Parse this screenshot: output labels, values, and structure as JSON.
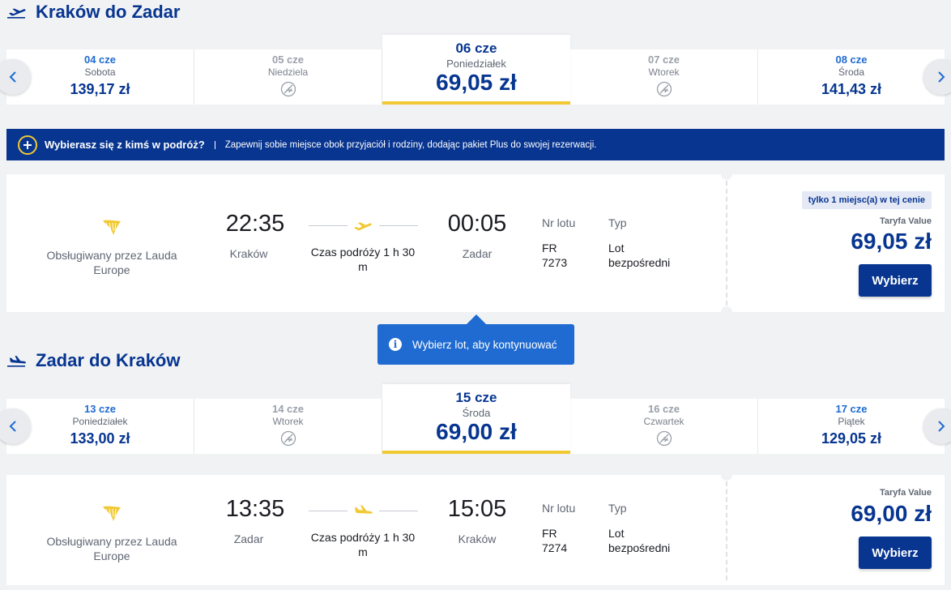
{
  "outbound": {
    "title": "Kraków do Zadar",
    "dates": [
      {
        "date": "04 cze",
        "weekday": "Sobota",
        "price": "139,17 zł",
        "available": true
      },
      {
        "date": "05 cze",
        "weekday": "Niedziela",
        "price": "",
        "available": false
      },
      {
        "date": "06 cze",
        "weekday": "Poniedziałek",
        "price": "69,05 zł",
        "available": true,
        "selected": true
      },
      {
        "date": "07 cze",
        "weekday": "Wtorek",
        "price": "",
        "available": false
      },
      {
        "date": "08 cze",
        "weekday": "Środa",
        "price": "141,43 zł",
        "available": true
      }
    ],
    "flight": {
      "operator": "Obsługiwany przez Lauda Europe",
      "dep_time": "22:35",
      "dep_city": "Kraków",
      "arr_time": "00:05",
      "arr_city": "Zadar",
      "duration": "Czas podróży 1 h 30 m",
      "flight_no_label": "Nr lotu",
      "flight_no": "FR 7273",
      "type_label": "Typ",
      "type": "Lot bezpośredni",
      "badge": "tylko 1 miejsc(a) w tej cenie",
      "tariff": "Taryfa Value",
      "price": "69,05 zł",
      "button": "Wybierz"
    }
  },
  "promo": {
    "title": "Wybierasz się z kimś w podróż?",
    "message": "Zapewnij sobie miejsce obok przyjaciół i rodziny, dodając pakiet Plus do swojej rezerwacji."
  },
  "tooltip": {
    "text": "Wybierz lot, aby kontynuować"
  },
  "inbound": {
    "title": "Zadar do Kraków",
    "dates": [
      {
        "date": "13 cze",
        "weekday": "Poniedziałek",
        "price": "133,00 zł",
        "available": true
      },
      {
        "date": "14 cze",
        "weekday": "Wtorek",
        "price": "",
        "available": false
      },
      {
        "date": "15 cze",
        "weekday": "Środa",
        "price": "69,00 zł",
        "available": true,
        "selected": true
      },
      {
        "date": "16 cze",
        "weekday": "Czwartek",
        "price": "",
        "available": false
      },
      {
        "date": "17 cze",
        "weekday": "Piątek",
        "price": "129,05 zł",
        "available": true
      }
    ],
    "flight": {
      "operator": "Obsługiwany przez Lauda Europe",
      "dep_time": "13:35",
      "dep_city": "Zadar",
      "arr_time": "15:05",
      "arr_city": "Kraków",
      "duration": "Czas podróży 1 h 30 m",
      "flight_no_label": "Nr lotu",
      "flight_no": "FR 7274",
      "type_label": "Typ",
      "type": "Lot bezpośredni",
      "tariff": "Taryfa Value",
      "price": "69,00 zł",
      "button": "Wybierz"
    }
  },
  "colors": {
    "brand": "#073590",
    "accent_yellow": "#f1c933",
    "link_blue": "#1f6bd1"
  }
}
